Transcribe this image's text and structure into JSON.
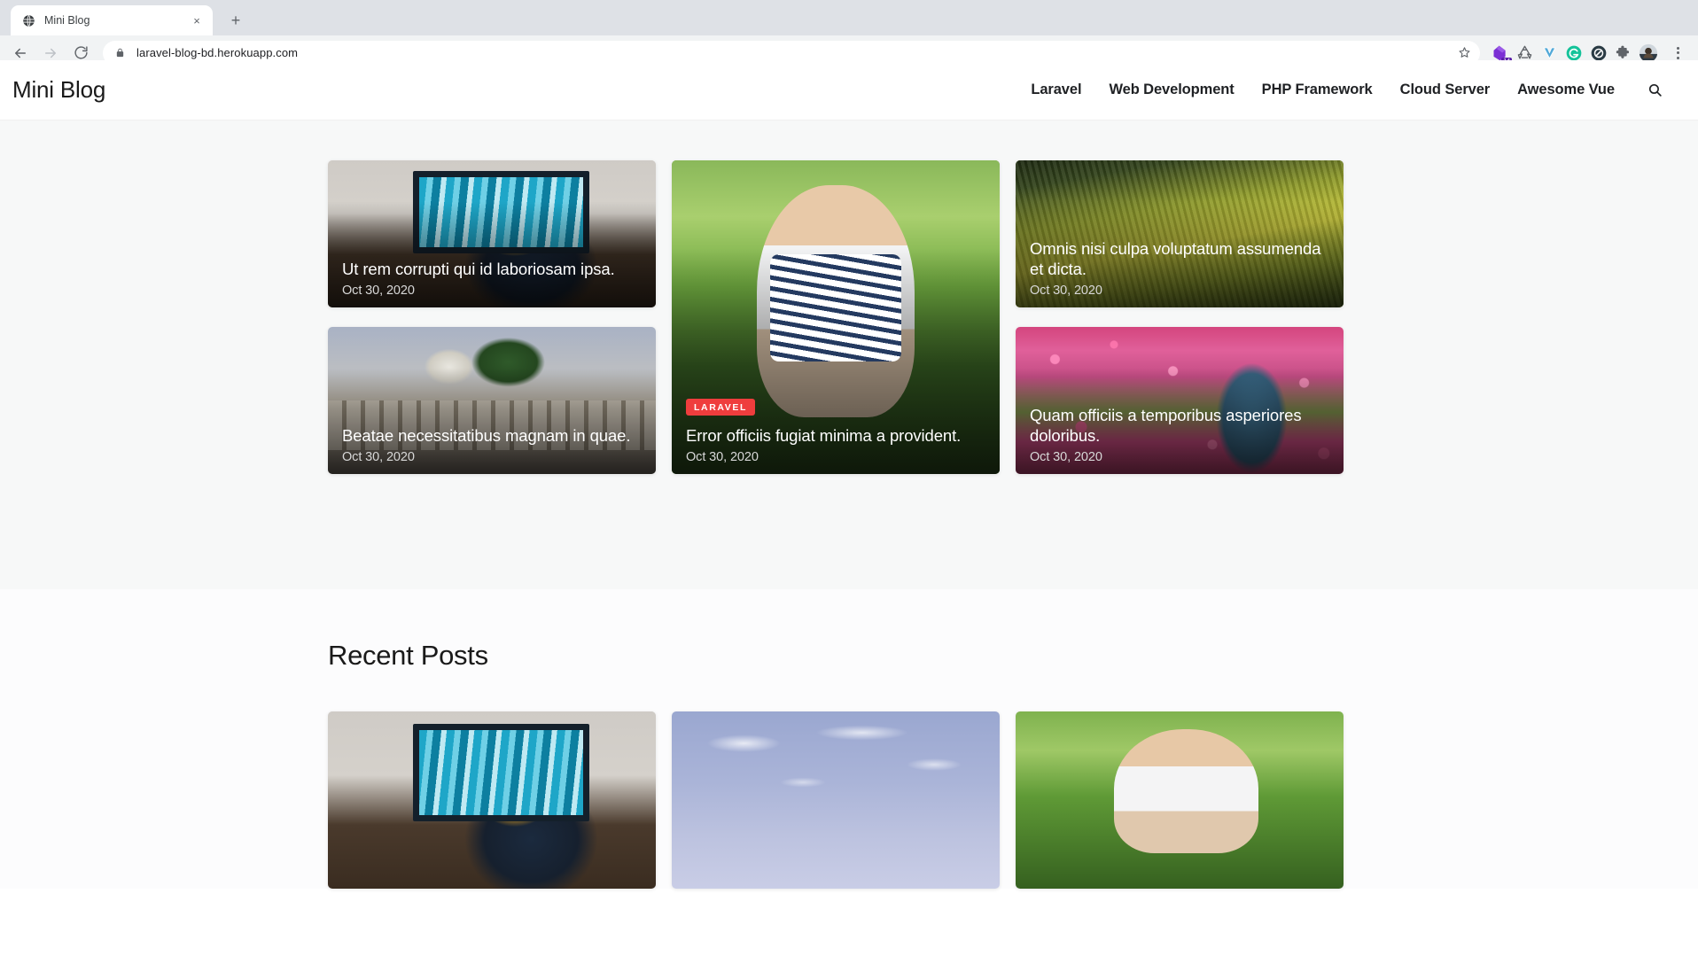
{
  "browser": {
    "tab": {
      "title": "Mini Blog",
      "favicon": "globe-icon",
      "close": "×"
    },
    "new_tab_label": "+",
    "back_label": "←",
    "forward_label": "→",
    "reload_label": "↻",
    "url": "laravel-blog-bd.herokuapp.com",
    "lock_icon": "lock-icon",
    "star_icon": "bookmark-star-icon",
    "extensions": [
      {
        "name": "grammarly-purple-extension-icon",
        "color": "#7b2fd4",
        "badge": "14"
      },
      {
        "name": "recycle-extension-icon",
        "color": "#5f6368"
      },
      {
        "name": "v-shaped-extension-icon",
        "color": "#4aa8d8"
      },
      {
        "name": "grammarly-green-extension-icon",
        "color": "#15c39a"
      },
      {
        "name": "adblock-extension-icon",
        "color": "#2b3c45"
      },
      {
        "name": "puzzle-extensions-icon",
        "color": "#5f6368"
      }
    ],
    "profile_avatar": "user-avatar",
    "menu_icon": "three-dot-menu-icon"
  },
  "site": {
    "brand": "Mini Blog",
    "nav": [
      {
        "label": "Laravel"
      },
      {
        "label": "Web Development"
      },
      {
        "label": "PHP Framework"
      },
      {
        "label": "Cloud Server"
      },
      {
        "label": "Awesome Vue"
      }
    ],
    "search_icon": "search-icon"
  },
  "hero": {
    "cards": [
      {
        "id": "card-ut-rem-corrupti",
        "title": "Ut rem corrupti qui id laboriosam ipsa.",
        "date": "Oct 30, 2020",
        "badge": null,
        "photo": "ph-desk",
        "photo_alt": "man-drinking-coffee-at-desk"
      },
      {
        "id": "card-error-officiis",
        "title": "Error officiis fugiat minima a provident.",
        "date": "Oct 30, 2020",
        "badge": "LARAVEL",
        "badge_color": "#ef3d3d",
        "photo": "ph-child",
        "photo_alt": "smiling-toddler-held-up-outdoors"
      },
      {
        "id": "card-omnis-nisi-culpa",
        "title": "Omnis nisi culpa voluptatum assumenda et dicta.",
        "date": "Oct 30, 2020",
        "badge": null,
        "photo": "ph-field",
        "photo_alt": "aerial-view-of-yellow-crop-field"
      },
      {
        "id": "card-beatae-necessitatibus",
        "title": "Beatae necessitatibus magnam in quae.",
        "date": "Oct 30, 2020",
        "badge": null,
        "photo": "ph-mosque",
        "photo_alt": "mosque-with-green-dome-and-minarets"
      },
      {
        "id": "card-quam-officiis",
        "title": "Quam officiis a temporibus asperiores doloribus.",
        "date": "Oct 30, 2020",
        "badge": null,
        "photo": "ph-flowers",
        "photo_alt": "woman-in-blue-dress-in-pink-flower-field"
      }
    ]
  },
  "recent": {
    "heading": "Recent Posts",
    "cards": [
      {
        "id": "recent-card-1",
        "photo": "ph-desk",
        "photo_alt": "man-drinking-coffee-at-desk"
      },
      {
        "id": "recent-card-2",
        "photo": "ph-sky",
        "photo_alt": "minaret-against-blue-sky"
      },
      {
        "id": "recent-card-3",
        "photo": "ph-child2",
        "photo_alt": "smiling-toddler-outdoors"
      }
    ]
  }
}
